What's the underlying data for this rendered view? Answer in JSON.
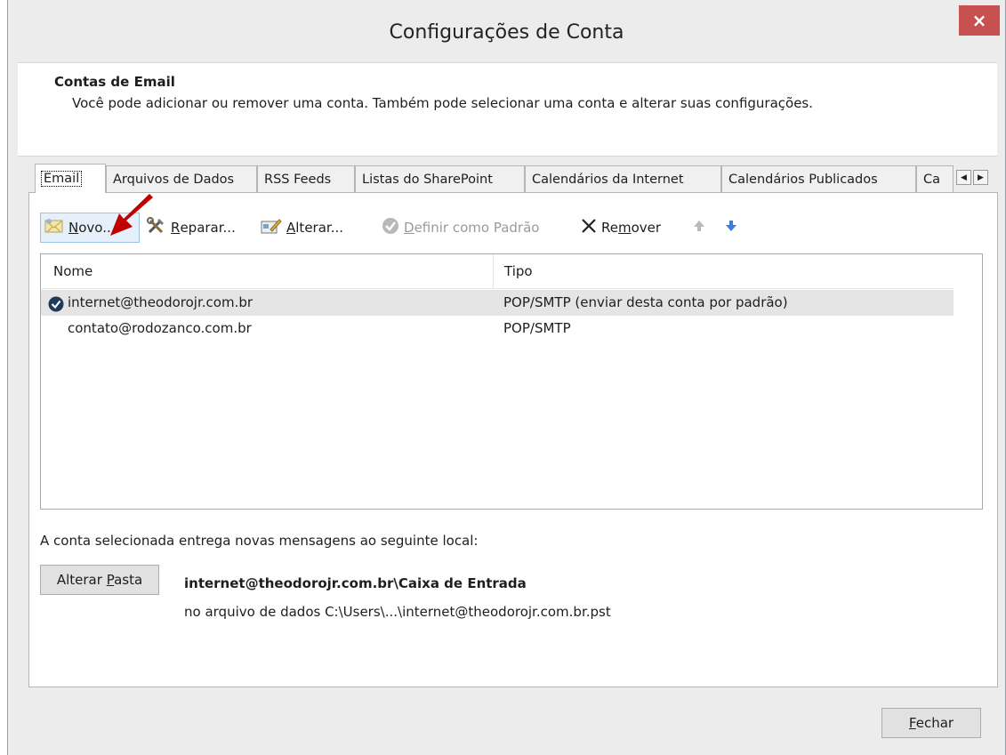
{
  "window": {
    "title": "Configurações de Conta",
    "close_label": "×"
  },
  "header": {
    "heading": "Contas de Email",
    "description": "Você pode adicionar ou remover uma conta. Também pode selecionar uma conta e alterar suas configurações."
  },
  "tabs": [
    {
      "label": "Email",
      "active": true
    },
    {
      "label": "Arquivos de Dados"
    },
    {
      "label": "RSS Feeds"
    },
    {
      "label": "Listas do SharePoint"
    },
    {
      "label": "Calendários da Internet"
    },
    {
      "label": "Calendários Publicados"
    },
    {
      "label": "Ca"
    }
  ],
  "tab_scroll": {
    "left": "◀",
    "right": "▶"
  },
  "toolbar": {
    "new": {
      "pre": "",
      "u": "N",
      "post": "ovo..."
    },
    "repair": {
      "pre": "",
      "u": "R",
      "post": "eparar..."
    },
    "change": {
      "pre": "",
      "u": "A",
      "post": "lterar..."
    },
    "default": {
      "pre": "",
      "u": "D",
      "post": "efinir como Padrão"
    },
    "remove": {
      "pre": "Re",
      "u": "m",
      "post": "over"
    },
    "icons": [
      "envelope-icon",
      "tools-icon",
      "edit-account-icon",
      "check-circle-icon",
      "x-icon",
      "arrow-up-icon",
      "arrow-down-icon"
    ]
  },
  "accounts": {
    "columns": [
      "Nome",
      "Tipo"
    ],
    "rows": [
      {
        "name": "internet@theodorojr.com.br",
        "type": "POP/SMTP (enviar desta conta por padrão)",
        "default": true
      },
      {
        "name": "contato@rodozanco.com.br",
        "type": "POP/SMTP"
      }
    ]
  },
  "delivery": {
    "label": "A conta selecionada entrega novas mensagens ao seguinte local:",
    "change_folder": {
      "pre": "Alterar ",
      "u": "P",
      "post": "asta"
    },
    "folder_path": "internet@theodorojr.com.br\\Caixa de Entrada",
    "data_file": "no arquivo de dados C:\\Users\\...\\internet@theodorojr.com.br.pst"
  },
  "footer": {
    "close": {
      "pre": "",
      "u": "F",
      "post": "echar"
    }
  },
  "colors": {
    "close_red": "#c75050",
    "selected_row": "#e5e5e5",
    "annotation_arrow": "#c00000",
    "hover_blue": "#e6f0fa"
  }
}
